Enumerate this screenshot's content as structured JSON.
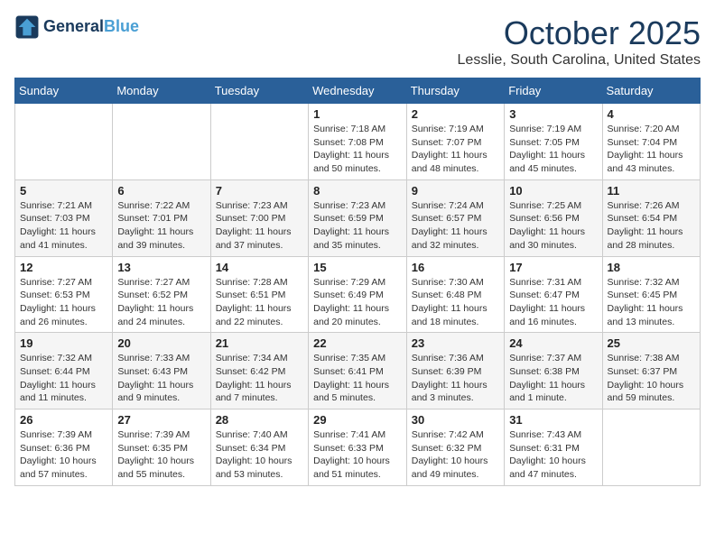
{
  "header": {
    "logo_line1": "General",
    "logo_line2": "Blue",
    "month": "October 2025",
    "location": "Lesslie, South Carolina, United States"
  },
  "weekdays": [
    "Sunday",
    "Monday",
    "Tuesday",
    "Wednesday",
    "Thursday",
    "Friday",
    "Saturday"
  ],
  "weeks": [
    [
      {
        "day": "",
        "info": ""
      },
      {
        "day": "",
        "info": ""
      },
      {
        "day": "",
        "info": ""
      },
      {
        "day": "1",
        "info": "Sunrise: 7:18 AM\nSunset: 7:08 PM\nDaylight: 11 hours\nand 50 minutes."
      },
      {
        "day": "2",
        "info": "Sunrise: 7:19 AM\nSunset: 7:07 PM\nDaylight: 11 hours\nand 48 minutes."
      },
      {
        "day": "3",
        "info": "Sunrise: 7:19 AM\nSunset: 7:05 PM\nDaylight: 11 hours\nand 45 minutes."
      },
      {
        "day": "4",
        "info": "Sunrise: 7:20 AM\nSunset: 7:04 PM\nDaylight: 11 hours\nand 43 minutes."
      }
    ],
    [
      {
        "day": "5",
        "info": "Sunrise: 7:21 AM\nSunset: 7:03 PM\nDaylight: 11 hours\nand 41 minutes."
      },
      {
        "day": "6",
        "info": "Sunrise: 7:22 AM\nSunset: 7:01 PM\nDaylight: 11 hours\nand 39 minutes."
      },
      {
        "day": "7",
        "info": "Sunrise: 7:23 AM\nSunset: 7:00 PM\nDaylight: 11 hours\nand 37 minutes."
      },
      {
        "day": "8",
        "info": "Sunrise: 7:23 AM\nSunset: 6:59 PM\nDaylight: 11 hours\nand 35 minutes."
      },
      {
        "day": "9",
        "info": "Sunrise: 7:24 AM\nSunset: 6:57 PM\nDaylight: 11 hours\nand 32 minutes."
      },
      {
        "day": "10",
        "info": "Sunrise: 7:25 AM\nSunset: 6:56 PM\nDaylight: 11 hours\nand 30 minutes."
      },
      {
        "day": "11",
        "info": "Sunrise: 7:26 AM\nSunset: 6:54 PM\nDaylight: 11 hours\nand 28 minutes."
      }
    ],
    [
      {
        "day": "12",
        "info": "Sunrise: 7:27 AM\nSunset: 6:53 PM\nDaylight: 11 hours\nand 26 minutes."
      },
      {
        "day": "13",
        "info": "Sunrise: 7:27 AM\nSunset: 6:52 PM\nDaylight: 11 hours\nand 24 minutes."
      },
      {
        "day": "14",
        "info": "Sunrise: 7:28 AM\nSunset: 6:51 PM\nDaylight: 11 hours\nand 22 minutes."
      },
      {
        "day": "15",
        "info": "Sunrise: 7:29 AM\nSunset: 6:49 PM\nDaylight: 11 hours\nand 20 minutes."
      },
      {
        "day": "16",
        "info": "Sunrise: 7:30 AM\nSunset: 6:48 PM\nDaylight: 11 hours\nand 18 minutes."
      },
      {
        "day": "17",
        "info": "Sunrise: 7:31 AM\nSunset: 6:47 PM\nDaylight: 11 hours\nand 16 minutes."
      },
      {
        "day": "18",
        "info": "Sunrise: 7:32 AM\nSunset: 6:45 PM\nDaylight: 11 hours\nand 13 minutes."
      }
    ],
    [
      {
        "day": "19",
        "info": "Sunrise: 7:32 AM\nSunset: 6:44 PM\nDaylight: 11 hours\nand 11 minutes."
      },
      {
        "day": "20",
        "info": "Sunrise: 7:33 AM\nSunset: 6:43 PM\nDaylight: 11 hours\nand 9 minutes."
      },
      {
        "day": "21",
        "info": "Sunrise: 7:34 AM\nSunset: 6:42 PM\nDaylight: 11 hours\nand 7 minutes."
      },
      {
        "day": "22",
        "info": "Sunrise: 7:35 AM\nSunset: 6:41 PM\nDaylight: 11 hours\nand 5 minutes."
      },
      {
        "day": "23",
        "info": "Sunrise: 7:36 AM\nSunset: 6:39 PM\nDaylight: 11 hours\nand 3 minutes."
      },
      {
        "day": "24",
        "info": "Sunrise: 7:37 AM\nSunset: 6:38 PM\nDaylight: 11 hours\nand 1 minute."
      },
      {
        "day": "25",
        "info": "Sunrise: 7:38 AM\nSunset: 6:37 PM\nDaylight: 10 hours\nand 59 minutes."
      }
    ],
    [
      {
        "day": "26",
        "info": "Sunrise: 7:39 AM\nSunset: 6:36 PM\nDaylight: 10 hours\nand 57 minutes."
      },
      {
        "day": "27",
        "info": "Sunrise: 7:39 AM\nSunset: 6:35 PM\nDaylight: 10 hours\nand 55 minutes."
      },
      {
        "day": "28",
        "info": "Sunrise: 7:40 AM\nSunset: 6:34 PM\nDaylight: 10 hours\nand 53 minutes."
      },
      {
        "day": "29",
        "info": "Sunrise: 7:41 AM\nSunset: 6:33 PM\nDaylight: 10 hours\nand 51 minutes."
      },
      {
        "day": "30",
        "info": "Sunrise: 7:42 AM\nSunset: 6:32 PM\nDaylight: 10 hours\nand 49 minutes."
      },
      {
        "day": "31",
        "info": "Sunrise: 7:43 AM\nSunset: 6:31 PM\nDaylight: 10 hours\nand 47 minutes."
      },
      {
        "day": "",
        "info": ""
      }
    ]
  ]
}
